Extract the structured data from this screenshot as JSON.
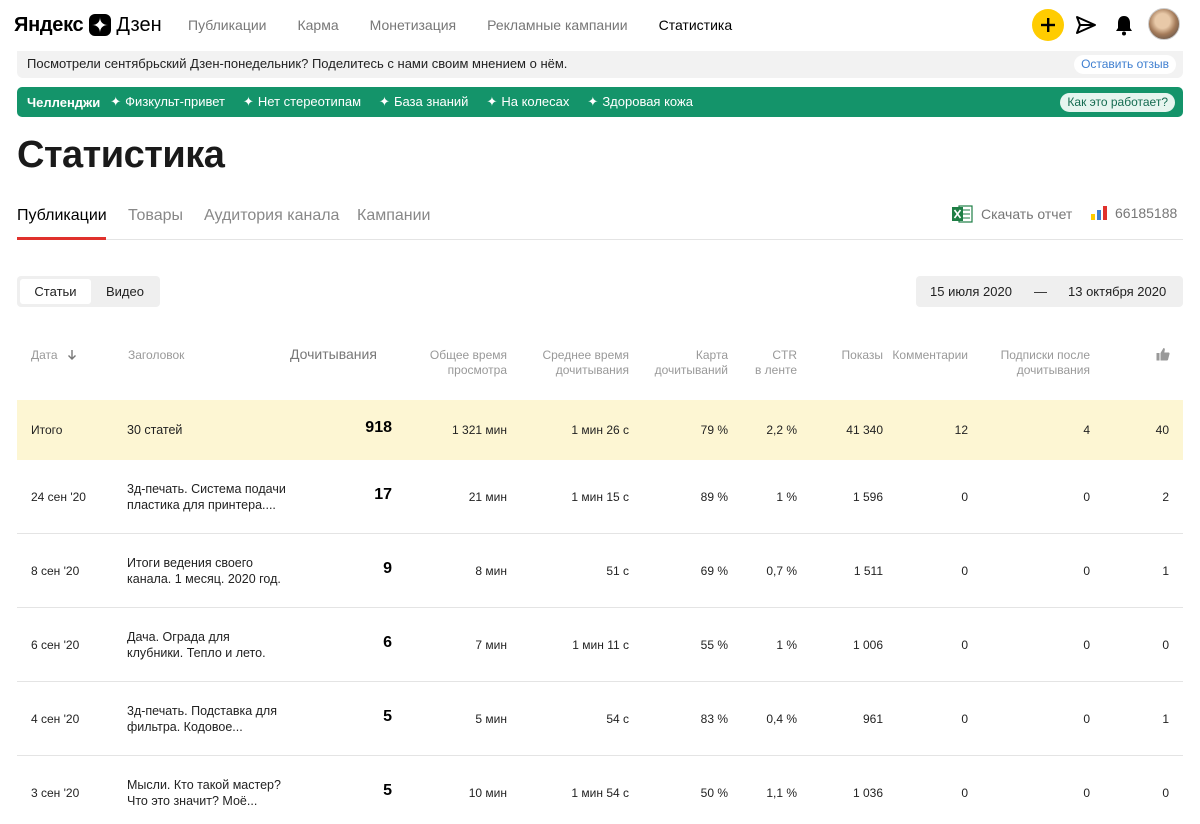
{
  "header": {
    "logo_yandex": "Яндекс",
    "logo_zen": "Дзен",
    "nav": [
      {
        "label": "Публикации"
      },
      {
        "label": "Карма"
      },
      {
        "label": "Монетизация"
      },
      {
        "label": "Рекламные кампании"
      },
      {
        "label": "Статистика",
        "active": true
      }
    ],
    "actions": [
      "plus-icon",
      "send-icon",
      "bell-icon",
      "avatar"
    ]
  },
  "banner": {
    "text": "Посмотрели сентябрьский Дзен-понедельник? Поделитесь с нами своим мнением о нём.",
    "button": "Оставить отзыв"
  },
  "challenges": {
    "title": "Челленджи",
    "items": [
      "Физкульт-привет",
      "Нет стереотипам",
      "База знаний",
      "На колесах",
      "Здоровая кожа"
    ],
    "button": "Как это работает?",
    "bg_color": "#14946a"
  },
  "page_title": "Статистика",
  "tabs": [
    {
      "label": "Публикации",
      "active": true
    },
    {
      "label": "Товары"
    },
    {
      "label": "Аудитория канала"
    },
    {
      "label": "Кампании"
    }
  ],
  "download_label": "Скачать отчет",
  "counter_id": "66185188",
  "segmented": {
    "active": "Статьи",
    "inactive": "Видео"
  },
  "date_range": {
    "from": "15 июля 2020",
    "dash": "—",
    "to": "13 октября 2020"
  },
  "table": {
    "columns": {
      "date": "Дата",
      "title": "Заголовок",
      "reads": "Дочитывания",
      "total_time_1": "Общее время",
      "total_time_2": "просмотра",
      "avg_time_1": "Среднее время",
      "avg_time_2": "дочитывания",
      "map_1": "Карта",
      "map_2": "дочитываний",
      "ctr_1": "CTR",
      "ctr_2": "в ленте",
      "shows": "Показы",
      "comments": "Комментарии",
      "subs_1": "Подписки после",
      "subs_2": "дочитывания"
    },
    "total": {
      "date": "Итого",
      "title": "30 статей",
      "reads": "918",
      "total_time": "1 321 мин",
      "avg_time": "1 мин 26 с",
      "map": "79 %",
      "ctr": "2,2 %",
      "shows": "41 340",
      "comments": "12",
      "subs": "4",
      "likes": "40"
    },
    "rows": [
      {
        "date": "24 сен '20",
        "title_1": "3д-печать. Система подачи",
        "title_2": "пластика для принтера....",
        "reads": "17",
        "total_time": "21 мин",
        "avg_time": "1 мин 15 с",
        "map": "89 %",
        "ctr": "1 %",
        "shows": "1 596",
        "comments": "0",
        "subs": "0",
        "likes": "2"
      },
      {
        "date": "8 сен '20",
        "title_1": "Итоги ведения своего",
        "title_2": "канала. 1 месяц. 2020 год.",
        "reads": "9",
        "total_time": "8 мин",
        "avg_time": "51 с",
        "map": "69 %",
        "ctr": "0,7 %",
        "shows": "1 511",
        "comments": "0",
        "subs": "0",
        "likes": "1"
      },
      {
        "date": "6 сен '20",
        "title_1": "Дача. Ограда для",
        "title_2": "клубники. Тепло и лето.",
        "reads": "6",
        "total_time": "7 мин",
        "avg_time": "1 мин 11 с",
        "map": "55 %",
        "ctr": "1 %",
        "shows": "1 006",
        "comments": "0",
        "subs": "0",
        "likes": "0"
      },
      {
        "date": "4 сен '20",
        "title_1": "3д-печать. Подставка для",
        "title_2": "фильтра. Кодовое...",
        "reads": "5",
        "total_time": "5 мин",
        "avg_time": "54 с",
        "map": "83 %",
        "ctr": "0,4 %",
        "shows": "961",
        "comments": "0",
        "subs": "0",
        "likes": "1"
      },
      {
        "date": "3 сен '20",
        "title_1": "Мысли. Кто такой мастер?",
        "title_2": "Что это значит? Моё...",
        "reads": "5",
        "total_time": "10 мин",
        "avg_time": "1 мин 54 с",
        "map": "50 %",
        "ctr": "1,1 %",
        "shows": "1 036",
        "comments": "0",
        "subs": "0",
        "likes": "0"
      }
    ]
  }
}
